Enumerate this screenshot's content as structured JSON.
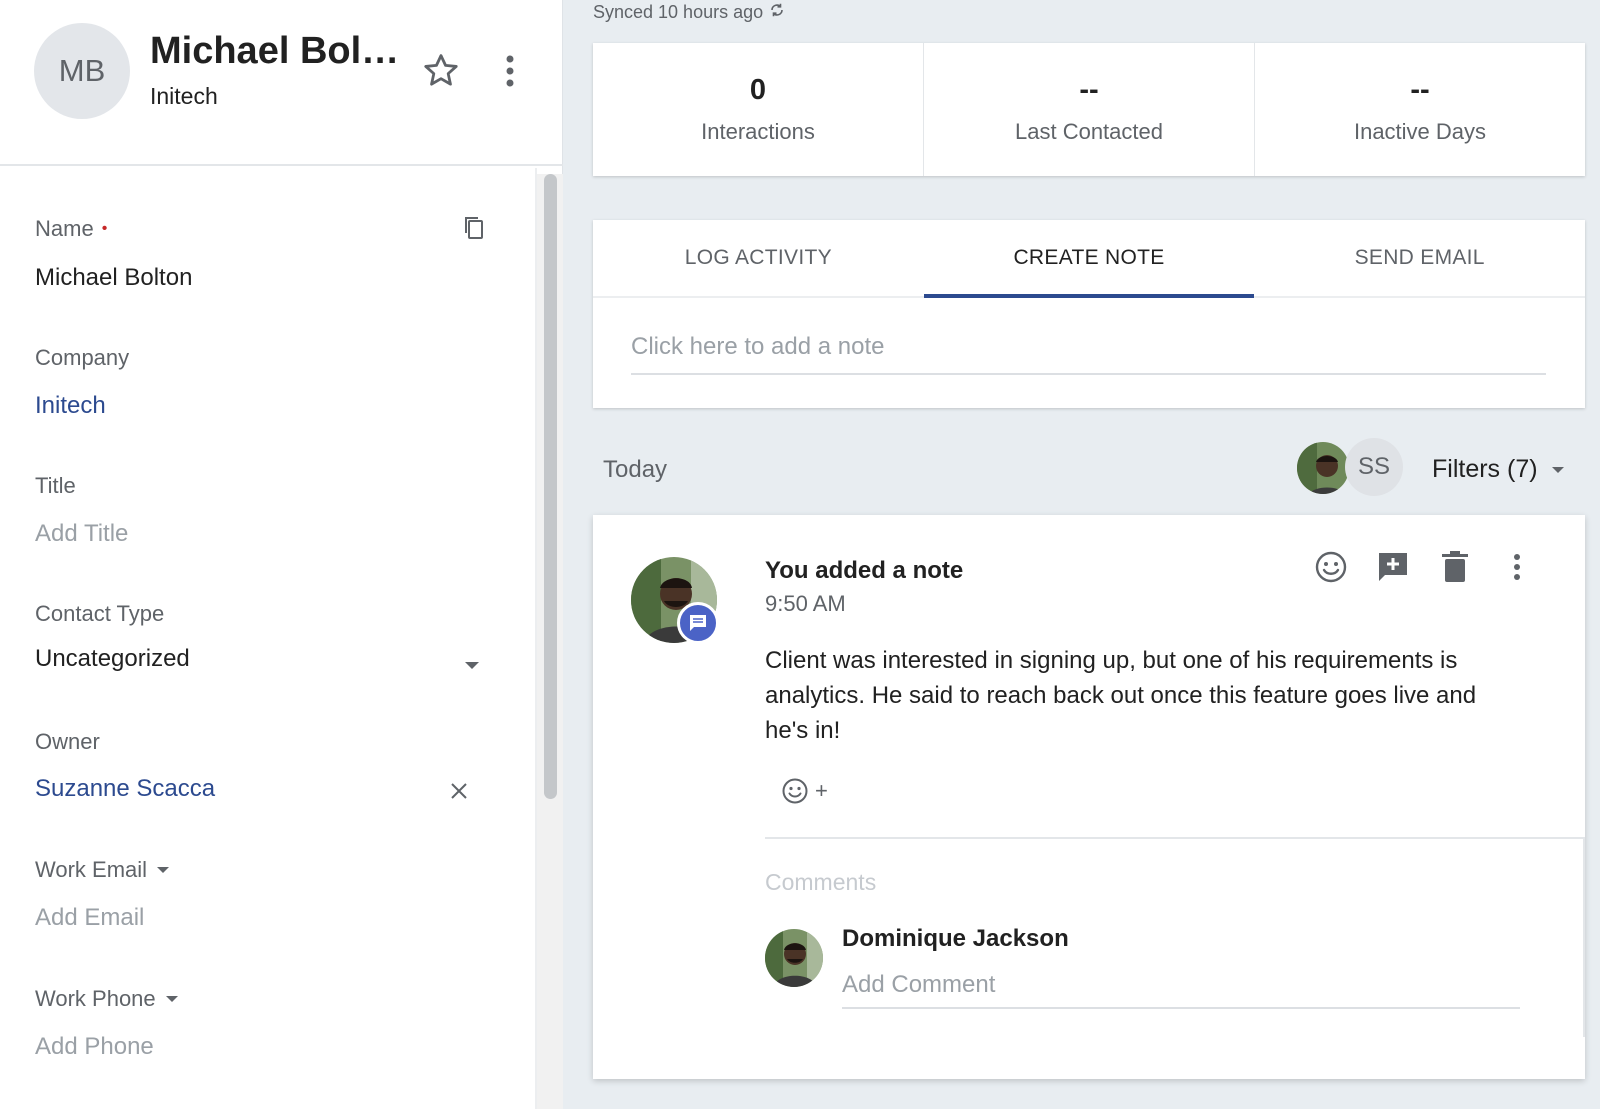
{
  "contact": {
    "initials": "MB",
    "name_display": "Michael Bol…",
    "company": "Initech"
  },
  "fields": {
    "name_label": "Name",
    "name_required_marker": "•",
    "name_value": "Michael Bolton",
    "company_label": "Company",
    "company_value": "Initech",
    "title_label": "Title",
    "title_placeholder": "Add Title",
    "contact_type_label": "Contact Type",
    "contact_type_value": "Uncategorized",
    "owner_label": "Owner",
    "owner_value": "Suzanne Scacca",
    "work_email_label": "Work Email",
    "work_email_placeholder": "Add Email",
    "work_phone_label": "Work Phone",
    "work_phone_placeholder": "Add Phone"
  },
  "sync": {
    "text": "Synced 10 hours ago"
  },
  "stats": [
    {
      "value": "0",
      "label": "Interactions"
    },
    {
      "value": "--",
      "label": "Last Contacted"
    },
    {
      "value": "--",
      "label": "Inactive Days"
    }
  ],
  "composer": {
    "tabs": [
      "LOG ACTIVITY",
      "CREATE NOTE",
      "SEND EMAIL"
    ],
    "active_tab": "CREATE NOTE",
    "note_placeholder": "Click here to add a note"
  },
  "timeline": {
    "day_label": "Today",
    "user_avatar_initials": "SS",
    "filters_label": "Filters (7)"
  },
  "note": {
    "title": "You added a note",
    "time": "9:50 AM",
    "body": "Client was interested in signing up, but one of his requirements is analytics. He said to reach back out once this feature goes live and he's in!",
    "reaction_plus": "+",
    "comments_label": "Comments",
    "commenter_name": "Dominique Jackson",
    "comment_placeholder": "Add Comment"
  },
  "colors": {
    "accent": "#2c4a8f",
    "note_badge": "#4b63c6",
    "required": "#c62828"
  }
}
